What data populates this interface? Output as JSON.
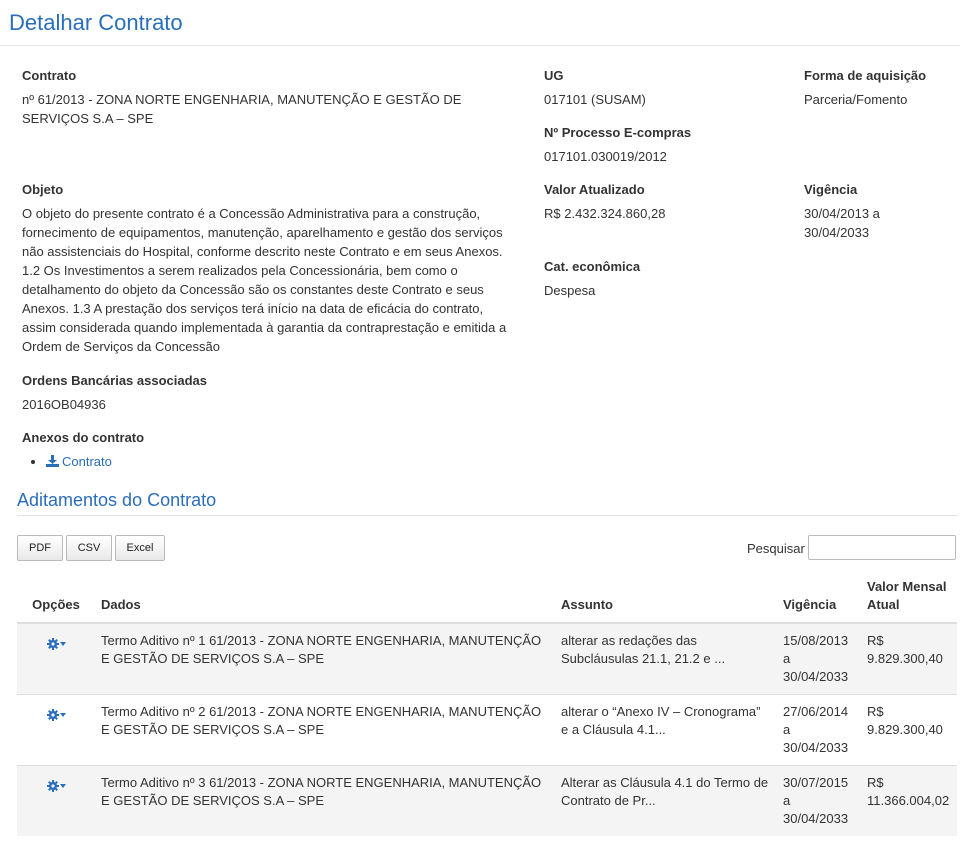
{
  "page": {
    "title": "Detalhar Contrato"
  },
  "contract": {
    "contrato_label": "Contrato",
    "contrato_value": "nº 61/2013 - ZONA NORTE ENGENHARIA, MANUTENÇÃO E GESTÃO DE SERVIÇOS S.A – SPE",
    "ug_label": "UG",
    "ug_value": "017101 (SUSAM)",
    "forma_label": "Forma de aquisição",
    "forma_value": "Parceria/Fomento",
    "processo_label": "Nº Processo E-compras",
    "processo_value": "017101.030019/2012",
    "objeto_label": "Objeto",
    "objeto_value": "O objeto do presente contrato é a Concessão Administrativa para a construção, fornecimento de equipamentos, manutenção, aparelhamento e gestão dos serviços não assistenciais do Hospital, conforme descrito neste Contrato e em seus Anexos. 1.2 Os Investimentos a serem realizados pela Concessionária, bem como o detalhamento do objeto da Concessão são os constantes deste Contrato e seus Anexos. 1.3 A prestação dos serviços terá início na data de eficácia do contrato, assim considerada quando implementada à garantia da contraprestação e emitida a Ordem de Serviços da Concessão",
    "valor_label": "Valor Atualizado",
    "valor_value": "R$ 2.432.324.860,28",
    "vigencia_label": "Vigência",
    "vigencia_value": "30/04/2013 a 30/04/2033",
    "cat_label": "Cat. econômica",
    "cat_value": "Despesa",
    "ordens_label": "Ordens Bancárias associadas",
    "ordens_value": "2016OB04936",
    "anexos_label": "Anexos do contrato",
    "anexos": [
      {
        "label": "Contrato",
        "icon": "download-icon"
      }
    ]
  },
  "aditamentos": {
    "title": "Aditamentos do Contrato",
    "buttons": {
      "pdf": "PDF",
      "csv": "CSV",
      "excel": "Excel"
    },
    "search_label": "Pesquisar",
    "search_value": "",
    "columns": {
      "opcoes": "Opções",
      "dados": "Dados",
      "assunto": "Assunto",
      "vigencia": "Vigência",
      "valor": "Valor Mensal Atual"
    },
    "rows": [
      {
        "dados": "Termo Aditivo nº 1 61/2013 - ZONA NORTE ENGENHARIA, MANUTENÇÃO E GESTÃO DE SERVIÇOS S.A – SPE",
        "assunto": "alterar as redações das Subcláusulas 21.1, 21.2 e ...",
        "vigencia": "15/08/2013 a 30/04/2033",
        "valor": "R$ 9.829.300,40"
      },
      {
        "dados": "Termo Aditivo nº 2 61/2013 - ZONA NORTE ENGENHARIA, MANUTENÇÃO E GESTÃO DE SERVIÇOS S.A – SPE",
        "assunto": "alterar o “Anexo IV – Cronograma” e a Cláusula 4.1...",
        "vigencia": "27/06/2014 a 30/04/2033",
        "valor": "R$ 9.829.300,40"
      },
      {
        "dados": "Termo Aditivo nº 3 61/2013 - ZONA NORTE ENGENHARIA, MANUTENÇÃO E GESTÃO DE SERVIÇOS S.A – SPE",
        "assunto": "Alterar as Cláusula 4.1 do Termo de Contrato de Pr...",
        "vigencia": "30/07/2015 a 30/04/2033",
        "valor": "R$ 11.366.004,02"
      }
    ]
  },
  "colors": {
    "accent": "#2a6ebb",
    "text": "#333333",
    "stripe": "#f4f4f4",
    "border": "#dddddd"
  }
}
